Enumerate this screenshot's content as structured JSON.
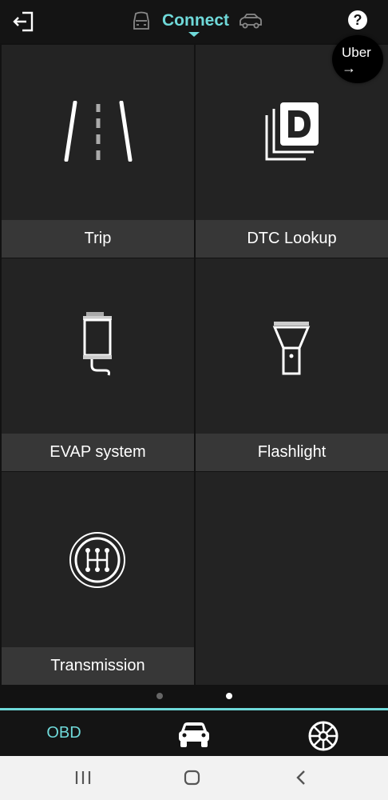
{
  "header": {
    "title": "Connect",
    "icons": {
      "back": "exit-arrow-icon",
      "vehicle_front": "car-front-icon",
      "vehicle_side": "car-side-icon",
      "help": "help-icon"
    },
    "help_glyph": "?",
    "accent_color": "#6fd9d9"
  },
  "uber": {
    "label": "Uber",
    "arrow": "→"
  },
  "tiles": [
    {
      "label": "Trip",
      "icon": "road-icon"
    },
    {
      "label": "DTC Lookup",
      "icon": "dtc-document-icon"
    },
    {
      "label": "EVAP system",
      "icon": "evap-canister-icon"
    },
    {
      "label": "Flashlight",
      "icon": "flashlight-icon"
    },
    {
      "label": "Transmission",
      "icon": "gear-shift-icon"
    }
  ],
  "pagination": {
    "pages": 2,
    "current": 2
  },
  "bottom_nav": {
    "obd_label": "OBD",
    "icons": {
      "vehicle": "car-icon",
      "wheel": "steering-wheel-icon"
    }
  },
  "system_nav": {
    "icons": [
      "recents-icon",
      "home-icon",
      "back-icon"
    ]
  }
}
